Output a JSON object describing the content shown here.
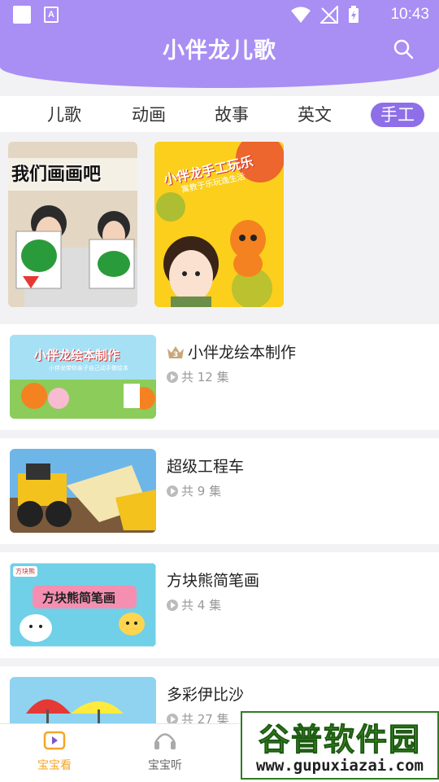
{
  "status_bar": {
    "time": "10:43",
    "a_icon_text": "A"
  },
  "header": {
    "title": "小伴龙儿歌"
  },
  "tabs": [
    {
      "label": "儿歌",
      "active": false
    },
    {
      "label": "动画",
      "active": false
    },
    {
      "label": "故事",
      "active": false
    },
    {
      "label": "英文",
      "active": false
    },
    {
      "label": "手工",
      "active": true
    }
  ],
  "featured": [
    {
      "art_text": "我们画画吧",
      "badge": ""
    },
    {
      "art_text": "小伴龙手工玩乐",
      "art_subtext": "寓教于乐玩逸生活"
    }
  ],
  "list": [
    {
      "name": "小伴龙绘本制作",
      "count": "共 12 集",
      "crown": true,
      "crown_num": "3",
      "art_text": "小伴龙绘本制作",
      "art_subtext": "小伴龙带你亲子自己动手做绘本"
    },
    {
      "name": "超级工程车",
      "count": "共 9 集",
      "crown": false
    },
    {
      "name": "方块熊简笔画",
      "count": "共 4 集",
      "crown": false,
      "art_text": "方块熊简笔画",
      "art_badge": "方块熊"
    },
    {
      "name": "多彩伊比沙",
      "count": "共 27 集",
      "crown": false
    }
  ],
  "bottom_nav": [
    {
      "label": "宝宝看",
      "active": true,
      "icon": "tv-play-icon"
    },
    {
      "label": "宝宝听",
      "active": false,
      "icon": "headphones-icon"
    }
  ],
  "watermark": {
    "line1": "谷普软件园",
    "line2": "www.gupuxiazai.com"
  },
  "colors": {
    "accent": "#a98ef4",
    "tab_active": "#8e6fe8",
    "nav_active": "#f5a623"
  }
}
